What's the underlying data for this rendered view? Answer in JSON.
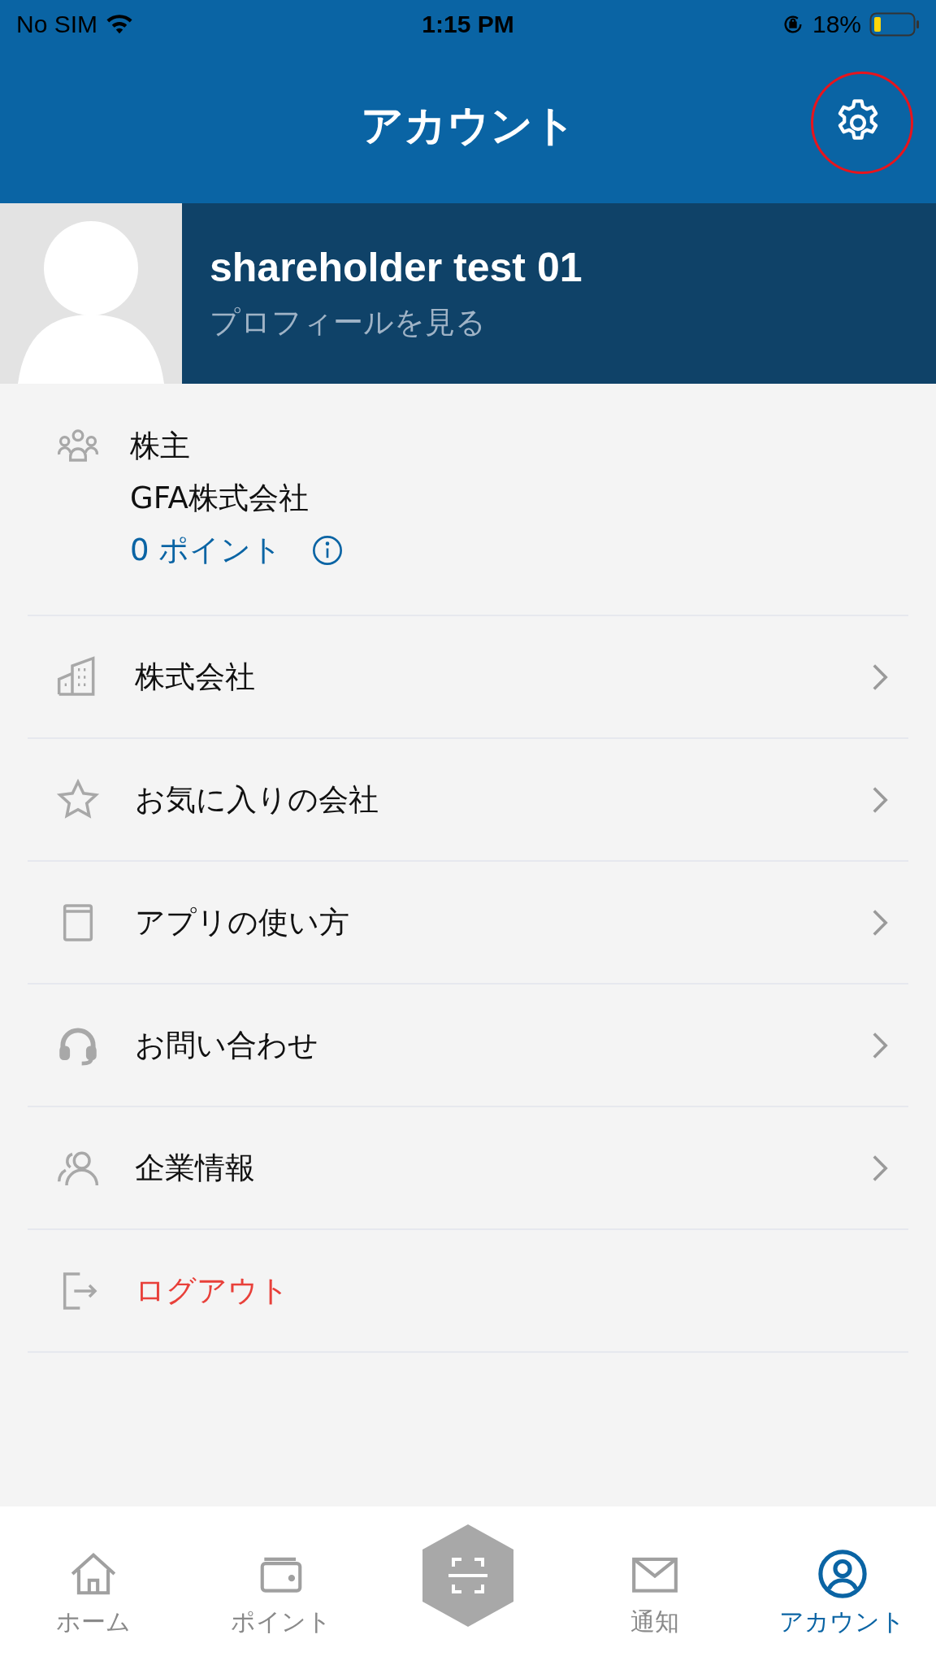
{
  "status_bar": {
    "carrier": "No SIM",
    "time": "1:15 PM",
    "battery": "18%"
  },
  "header": {
    "title": "アカウント",
    "settings_highlighted": true
  },
  "profile": {
    "name": "shareholder test 01",
    "link": "プロフィールを見る"
  },
  "membership": {
    "role": "株主",
    "company": "GFA株式会社",
    "points": "0 ポイント"
  },
  "menu": [
    {
      "kind": "building",
      "label": "株式会社",
      "chevron": true,
      "destructive": false
    },
    {
      "kind": "star",
      "label": "お気に入りの会社",
      "chevron": true,
      "destructive": false
    },
    {
      "kind": "book",
      "label": "アプリの使い方",
      "chevron": true,
      "destructive": false
    },
    {
      "kind": "headset",
      "label": "お問い合わせ",
      "chevron": true,
      "destructive": false
    },
    {
      "kind": "people",
      "label": "企業情報",
      "chevron": true,
      "destructive": false
    },
    {
      "kind": "logout",
      "label": "ログアウト",
      "chevron": false,
      "destructive": true
    }
  ],
  "tab_bar": [
    {
      "kind": "home",
      "label": "ホーム",
      "selected": false
    },
    {
      "kind": "wallet",
      "label": "ポイント",
      "selected": false
    },
    {
      "kind": "scan",
      "selected": false
    },
    {
      "kind": "mail",
      "label": "通知",
      "selected": false
    },
    {
      "kind": "account",
      "label": "アカウント",
      "selected": true
    }
  ]
}
